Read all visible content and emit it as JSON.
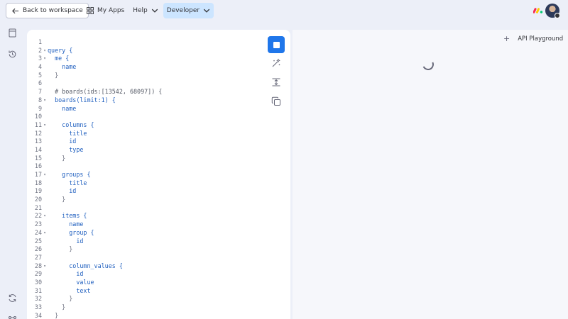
{
  "topbar": {
    "back_label": "Back to workspace",
    "nav": [
      {
        "label": "My Apps",
        "icon": "grid-icon"
      },
      {
        "label": "Help",
        "icon": "chevron-down-icon"
      },
      {
        "label": "Developer",
        "icon": "chevron-down-icon",
        "active": true
      }
    ]
  },
  "result": {
    "playground_label": "API Playground"
  },
  "colors": {
    "accent": "#1f76ea",
    "active_nav": "#cce5ff",
    "code_keyword": "#1f5fbf"
  },
  "code": {
    "lines": [
      {
        "n": "1",
        "fold": "",
        "text": "",
        "kind": "plain"
      },
      {
        "n": "2",
        "fold": "▾",
        "text": "query {",
        "kind": "plain"
      },
      {
        "n": "3",
        "fold": "▾",
        "text": "  me {",
        "kind": "plain"
      },
      {
        "n": "4",
        "fold": "",
        "text": "    name",
        "kind": "plain"
      },
      {
        "n": "5",
        "fold": "",
        "text": "  }",
        "kind": "brace"
      },
      {
        "n": "6",
        "fold": "",
        "text": "",
        "kind": "plain"
      },
      {
        "n": "7",
        "fold": "",
        "text": "  # boards(ids:[13542, 68097]) {",
        "kind": "comment"
      },
      {
        "n": "8",
        "fold": "▾",
        "text": "  boards(limit:1) {",
        "kind": "plain"
      },
      {
        "n": "9",
        "fold": "",
        "text": "    name",
        "kind": "plain"
      },
      {
        "n": "10",
        "fold": "",
        "text": "",
        "kind": "plain"
      },
      {
        "n": "11",
        "fold": "▾",
        "text": "    columns {",
        "kind": "plain"
      },
      {
        "n": "12",
        "fold": "",
        "text": "      title",
        "kind": "plain"
      },
      {
        "n": "13",
        "fold": "",
        "text": "      id",
        "kind": "plain"
      },
      {
        "n": "14",
        "fold": "",
        "text": "      type",
        "kind": "plain"
      },
      {
        "n": "15",
        "fold": "",
        "text": "    }",
        "kind": "brace"
      },
      {
        "n": "16",
        "fold": "",
        "text": "",
        "kind": "plain"
      },
      {
        "n": "17",
        "fold": "▾",
        "text": "    groups {",
        "kind": "plain"
      },
      {
        "n": "18",
        "fold": "",
        "text": "      title",
        "kind": "plain"
      },
      {
        "n": "19",
        "fold": "",
        "text": "      id",
        "kind": "plain"
      },
      {
        "n": "20",
        "fold": "",
        "text": "    }",
        "kind": "brace"
      },
      {
        "n": "21",
        "fold": "",
        "text": "",
        "kind": "plain"
      },
      {
        "n": "22",
        "fold": "▾",
        "text": "    items {",
        "kind": "plain"
      },
      {
        "n": "23",
        "fold": "",
        "text": "      name",
        "kind": "plain"
      },
      {
        "n": "24",
        "fold": "▾",
        "text": "      group {",
        "kind": "plain"
      },
      {
        "n": "25",
        "fold": "",
        "text": "        id",
        "kind": "plain"
      },
      {
        "n": "26",
        "fold": "",
        "text": "      }",
        "kind": "brace"
      },
      {
        "n": "27",
        "fold": "",
        "text": "",
        "kind": "plain"
      },
      {
        "n": "28",
        "fold": "▾",
        "text": "      column_values {",
        "kind": "plain"
      },
      {
        "n": "29",
        "fold": "",
        "text": "        id",
        "kind": "plain"
      },
      {
        "n": "30",
        "fold": "",
        "text": "        value",
        "kind": "plain"
      },
      {
        "n": "31",
        "fold": "",
        "text": "        text",
        "kind": "plain"
      },
      {
        "n": "32",
        "fold": "",
        "text": "      }",
        "kind": "brace"
      },
      {
        "n": "33",
        "fold": "",
        "text": "    }",
        "kind": "brace"
      },
      {
        "n": "34",
        "fold": "",
        "text": "  }",
        "kind": "brace"
      }
    ]
  }
}
